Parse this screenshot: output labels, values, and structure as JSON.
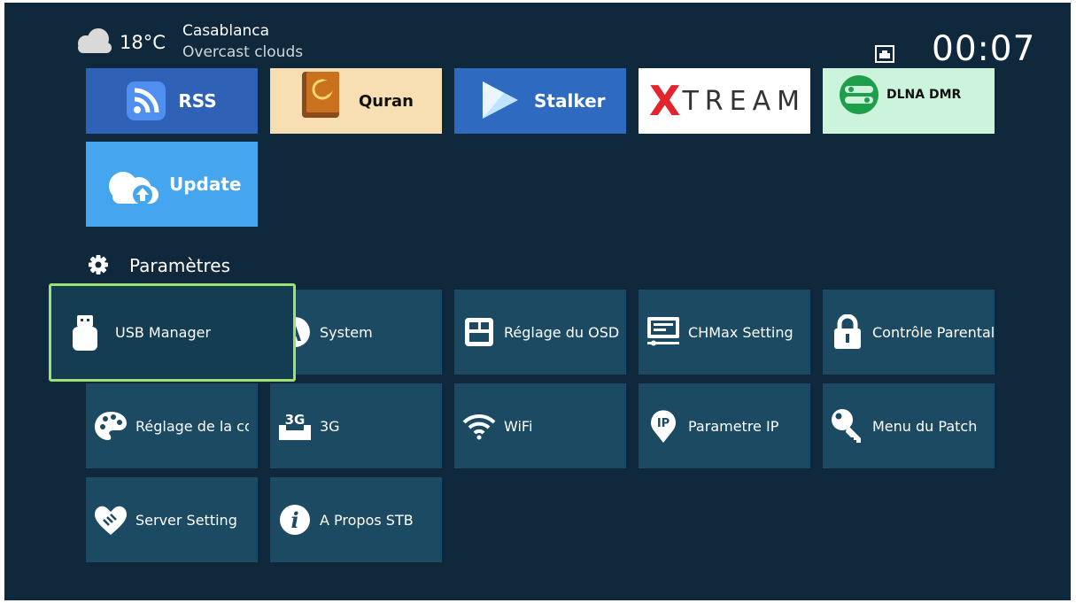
{
  "header": {
    "weather_icon": "cloud-icon",
    "temperature": "18°C",
    "city": "Casablanca",
    "condition": "Overcast clouds",
    "network_icon": "ethernet-icon",
    "clock": "00:07"
  },
  "apps": {
    "rss": {
      "label": "RSS",
      "icon": "rss-icon"
    },
    "quran": {
      "label": "Quran",
      "icon": "quran-book-icon"
    },
    "stalker": {
      "label": "Stalker",
      "icon": "play-icon"
    },
    "xtream": {
      "label": "TREAM",
      "logo_letter": "X"
    },
    "dlna": {
      "label": "DLNA DMR",
      "icon": "dlna-icon"
    },
    "update": {
      "label": "Update",
      "icon": "cloud-upload-icon"
    }
  },
  "settings": {
    "title": "Paramètres",
    "title_icon": "gear-icon",
    "focused_item": "USB Manager",
    "focus_color": "#9be26e",
    "items": [
      {
        "label": "USB Manager",
        "icon": "usb-drive-icon"
      },
      {
        "label": "System",
        "icon": "system-icon"
      },
      {
        "label": "Réglage du OSD",
        "icon": "osd-icon"
      },
      {
        "label": "CHMax Setting",
        "icon": "monitor-icon"
      },
      {
        "label": "Contrôle Parental",
        "icon": "lock-icon"
      },
      {
        "label": "Réglage de la couleur",
        "icon": "palette-icon"
      },
      {
        "label": "3G",
        "icon": "3g-icon"
      },
      {
        "label": "WiFi",
        "icon": "wifi-icon"
      },
      {
        "label": "Parametre IP",
        "icon": "ip-pin-icon"
      },
      {
        "label": "Menu du Patch",
        "icon": "key-icon"
      },
      {
        "label": "Server Setting",
        "icon": "handshake-icon"
      },
      {
        "label": "A Propos STB",
        "icon": "info-icon"
      }
    ]
  }
}
